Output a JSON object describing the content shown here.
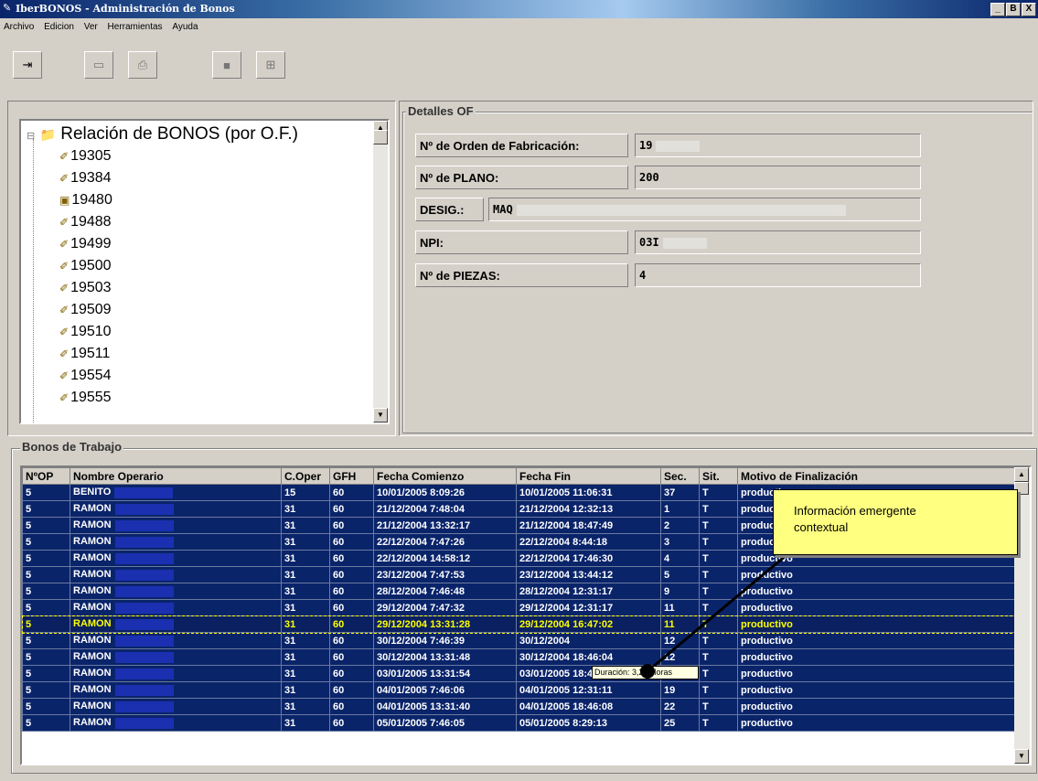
{
  "window": {
    "title": "IberBONOS - Administración de Bonos",
    "controls": [
      "_",
      "B",
      "X"
    ]
  },
  "menu": [
    "Archivo",
    "Edicion",
    "Ver",
    "Herramientas",
    "Ayuda"
  ],
  "tree": {
    "root": "Relación de BONOS (por O.F.)",
    "items": [
      "19305",
      "19384",
      "19480",
      "19488",
      "19499",
      "19500",
      "19503",
      "19509",
      "19510",
      "19511",
      "19554",
      "19555"
    ]
  },
  "details": {
    "title": "Detalles OF",
    "of_label": "Nº de Orden de Fabricación:",
    "of_value": "19",
    "plano_label": "Nº de PLANO:",
    "plano_value": "200",
    "desig_label": "DESIG.:",
    "desig_value": "MAQ",
    "npi_label": "NPI:",
    "npi_value": "03I",
    "piezas_label": "Nº de PIEZAS:",
    "piezas_value": "4"
  },
  "bonos": {
    "title": "Bonos de Trabajo",
    "columns": [
      "NºOP",
      "Nombre Operario",
      "C.Oper",
      "GFH",
      "Fecha Comienzo",
      "Fecha Fin",
      "Sec.",
      "Sit.",
      "Motivo de Finalización"
    ],
    "rows": [
      [
        "5",
        "BENITO",
        "15",
        "60",
        "10/01/2005 8:09:26",
        "10/01/2005 11:06:31",
        "37",
        "T",
        "productivo"
      ],
      [
        "5",
        "RAMON",
        "31",
        "60",
        "21/12/2004 7:48:04",
        "21/12/2004 12:32:13",
        "1",
        "T",
        "productivo"
      ],
      [
        "5",
        "RAMON",
        "31",
        "60",
        "21/12/2004 13:32:17",
        "21/12/2004 18:47:49",
        "2",
        "T",
        "productivo"
      ],
      [
        "5",
        "RAMON",
        "31",
        "60",
        "22/12/2004 7:47:26",
        "22/12/2004 8:44:18",
        "3",
        "T",
        "productivo"
      ],
      [
        "5",
        "RAMON",
        "31",
        "60",
        "22/12/2004 14:58:12",
        "22/12/2004 17:46:30",
        "4",
        "T",
        "productivo"
      ],
      [
        "5",
        "RAMON",
        "31",
        "60",
        "23/12/2004 7:47:53",
        "23/12/2004 13:44:12",
        "5",
        "T",
        "productivo"
      ],
      [
        "5",
        "RAMON",
        "31",
        "60",
        "28/12/2004 7:46:48",
        "28/12/2004 12:31:17",
        "9",
        "T",
        "productivo"
      ],
      [
        "5",
        "RAMON",
        "31",
        "60",
        "29/12/2004 7:47:32",
        "29/12/2004 12:31:17",
        "11",
        "T",
        "productivo"
      ],
      [
        "5",
        "RAMON",
        "31",
        "60",
        "29/12/2004 13:31:28",
        "29/12/2004 16:47:02",
        "11",
        "T",
        "productivo"
      ],
      [
        "5",
        "RAMON",
        "31",
        "60",
        "30/12/2004 7:46:39",
        "30/12/2004",
        "12",
        "T",
        "productivo"
      ],
      [
        "5",
        "RAMON",
        "31",
        "60",
        "30/12/2004 13:31:48",
        "30/12/2004 18:46:04",
        "12",
        "T",
        "productivo"
      ],
      [
        "5",
        "RAMON",
        "31",
        "60",
        "03/01/2005 13:31:54",
        "03/01/2005 18:46:39",
        "17",
        "T",
        "productivo"
      ],
      [
        "5",
        "RAMON",
        "31",
        "60",
        "04/01/2005 7:46:06",
        "04/01/2005 12:31:11",
        "19",
        "T",
        "productivo"
      ],
      [
        "5",
        "RAMON",
        "31",
        "60",
        "04/01/2005 13:31:40",
        "04/01/2005 18:46:08",
        "22",
        "T",
        "productivo"
      ],
      [
        "5",
        "RAMON",
        "31",
        "60",
        "05/01/2005 7:46:05",
        "05/01/2005 8:29:13",
        "25",
        "T",
        "productivo"
      ]
    ],
    "selected_row": 8
  },
  "callout": {
    "line1": "Información emergente",
    "line2": "contextual"
  },
  "tooltip": "Duración: 3,26 Horas"
}
